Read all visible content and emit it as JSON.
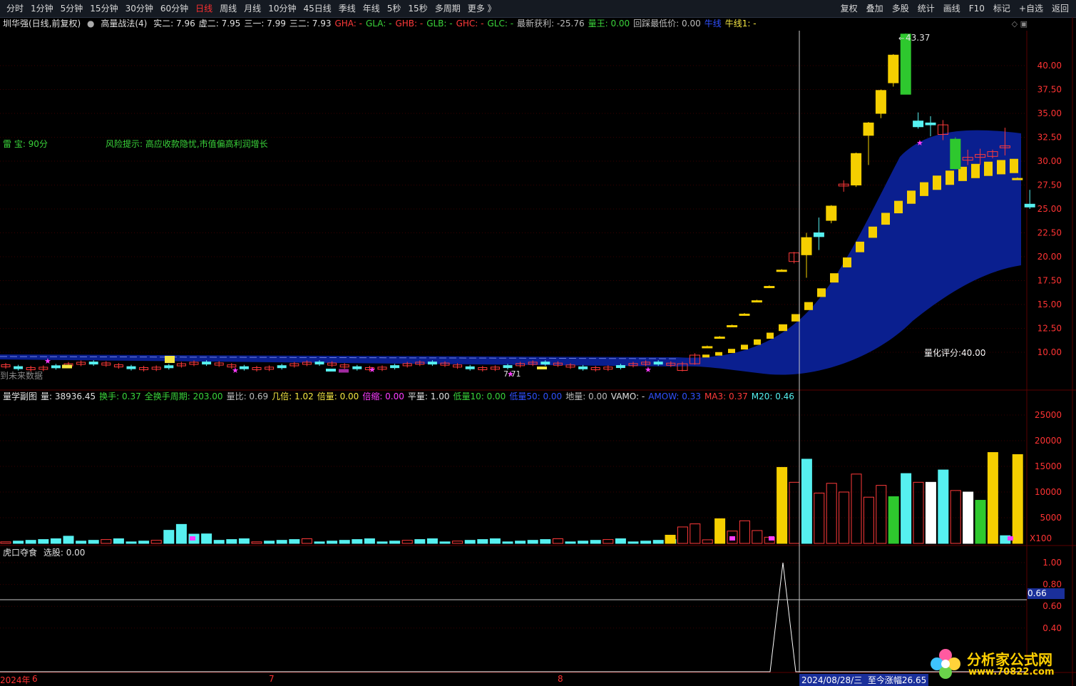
{
  "toolbar": {
    "periods": [
      "分时",
      "1分钟",
      "5分钟",
      "15分钟",
      "30分钟",
      "60分钟",
      "日线",
      "周线",
      "月线",
      "10分钟",
      "45日线",
      "季线",
      "年线",
      "5秒",
      "15秒",
      "多周期",
      "更多 》"
    ],
    "active_period": "日线",
    "tools": [
      "复权",
      "叠加",
      "多股",
      "统计",
      "画线",
      "F10",
      "标记",
      "+自选",
      "返回"
    ]
  },
  "main_info": {
    "stock": "圳华强(日线,前复权)",
    "indicator": "高量战法(4)",
    "items": [
      {
        "t": "实二: 7.96",
        "c": "white"
      },
      {
        "t": "虚二: 7.95",
        "c": "white"
      },
      {
        "t": "三一: 7.99",
        "c": "white"
      },
      {
        "t": "三二: 7.93",
        "c": "white"
      },
      {
        "t": "GHA: -",
        "c": "red"
      },
      {
        "t": "GLA: -",
        "c": "green"
      },
      {
        "t": "GHB: -",
        "c": "red"
      },
      {
        "t": "GLB: -",
        "c": "green"
      },
      {
        "t": "GHC: -",
        "c": "red"
      },
      {
        "t": "GLC: -",
        "c": "green"
      },
      {
        "t": "最新获利: -25.76",
        "c": "gray"
      },
      {
        "t": "量王: 0.00",
        "c": "green"
      },
      {
        "t": "回踩最低价: 0.00",
        "c": "gray"
      },
      {
        "t": "牛线",
        "c": "blue"
      },
      {
        "t": "牛线1: -",
        "c": "yellow"
      }
    ]
  },
  "annotations": {
    "radar": "雷 宝:   90分",
    "radar_prefix": "雷",
    "risk": "风险提示:   高应收款隐忧,市值偏高利润增长",
    "future": "到未来数据",
    "score": "量化评分:40.00",
    "high_label": "43.37",
    "low_label": "7.71"
  },
  "volume_info": {
    "items": [
      {
        "t": "量学副图",
        "c": "white"
      },
      {
        "t": "量: 38936.45",
        "c": "white"
      },
      {
        "t": "换手: 0.37",
        "c": "green"
      },
      {
        "t": "全换手周期: 203.00",
        "c": "green"
      },
      {
        "t": "量比: 0.69",
        "c": "gray"
      },
      {
        "t": "几倍: 1.02",
        "c": "yellow"
      },
      {
        "t": "倍量: 0.00",
        "c": "yellow"
      },
      {
        "t": "倍缩: 0.00",
        "c": "magenta"
      },
      {
        "t": "平量: 1.00",
        "c": "white"
      },
      {
        "t": "低量10: 0.00",
        "c": "green"
      },
      {
        "t": "低量50: 0.00",
        "c": "blue"
      },
      {
        "t": "地量: 0.00",
        "c": "gray"
      },
      {
        "t": "VAMO: -",
        "c": "white"
      },
      {
        "t": "AMOW: 0.33",
        "c": "blue"
      },
      {
        "t": "MA3: 0.37",
        "c": "red"
      },
      {
        "t": "M20: 0.46",
        "c": "cyan"
      }
    ],
    "unit": "X100"
  },
  "sub_info": {
    "title": "虎口夺食",
    "select": "选股: 0.00",
    "current": "0.66"
  },
  "date_axis": {
    "year": "2024年",
    "months": [
      "6",
      "7",
      "8"
    ],
    "cursor_date": "2024/08/28/三",
    "gain": "至今涨幅26.65"
  },
  "watermark": {
    "name": "分析家公式网",
    "url": "www.70822.com"
  },
  "chart_data": [
    {
      "type": "candlestick",
      "title": "高量战法(4)",
      "ylim": [
        7.5,
        43.5
      ],
      "y_ticks": [
        "40.00",
        "37.50",
        "35.00",
        "32.50",
        "30.00",
        "27.50",
        "25.00",
        "22.50",
        "20.00",
        "17.50",
        "15.00",
        "12.50",
        "10.00"
      ],
      "late_candles": [
        {
          "o": 8.1,
          "c": 8.8,
          "h": 9.0,
          "l": 8.0
        },
        {
          "o": 8.8,
          "c": 9.7,
          "h": 9.9,
          "l": 8.7
        },
        {
          "o": 10.6,
          "c": 10.6,
          "h": 10.7,
          "l": 10.5
        },
        {
          "o": 11.6,
          "c": 11.6,
          "h": 11.7,
          "l": 11.5
        },
        {
          "o": 12.8,
          "c": 12.8,
          "h": 12.9,
          "l": 12.7
        },
        {
          "o": 14.0,
          "c": 14.0,
          "h": 14.1,
          "l": 13.9
        },
        {
          "o": 15.4,
          "c": 15.4,
          "h": 15.5,
          "l": 15.3
        },
        {
          "o": 16.9,
          "c": 16.9,
          "h": 17.0,
          "l": 16.8
        },
        {
          "o": 18.6,
          "c": 18.6,
          "h": 18.7,
          "l": 18.5
        },
        {
          "o": 19.5,
          "c": 20.4,
          "h": 20.5,
          "l": 19.3
        },
        {
          "o": 20.2,
          "c": 22.0,
          "h": 22.5,
          "l": 17.8
        },
        {
          "o": 22.5,
          "c": 22.1,
          "h": 24.1,
          "l": 20.7
        },
        {
          "o": 23.8,
          "c": 25.3,
          "h": 25.4,
          "l": 23.5
        },
        {
          "o": 27.4,
          "c": 27.6,
          "h": 28.0,
          "l": 26.8
        },
        {
          "o": 27.5,
          "c": 30.8,
          "h": 30.9,
          "l": 27.3
        },
        {
          "o": 32.7,
          "c": 34.0,
          "h": 34.1,
          "l": 29.6
        },
        {
          "o": 35.0,
          "c": 37.4,
          "h": 37.5,
          "l": 34.5
        },
        {
          "o": 38.2,
          "c": 41.1,
          "h": 41.2,
          "l": 37.8
        },
        {
          "o": 43.3,
          "c": 37.0,
          "h": 43.37,
          "l": 37.0
        },
        {
          "o": 34.2,
          "c": 33.6,
          "h": 35.1,
          "l": 33.4
        },
        {
          "o": 34.0,
          "c": 33.8,
          "h": 34.7,
          "l": 32.6
        },
        {
          "o": 32.8,
          "c": 33.8,
          "h": 34.3,
          "l": 32.2
        },
        {
          "o": 32.3,
          "c": 29.2,
          "h": 32.5,
          "l": 29.2
        },
        {
          "o": 30.1,
          "c": 30.4,
          "h": 31.2,
          "l": 29.6
        },
        {
          "o": 30.4,
          "c": 30.7,
          "h": 31.3,
          "l": 29.6
        },
        {
          "o": 30.5,
          "c": 31.0,
          "h": 31.2,
          "l": 30.3
        },
        {
          "o": 31.4,
          "c": 31.6,
          "h": 33.5,
          "l": 30.6
        },
        {
          "o": 28.2,
          "c": 28.2,
          "h": 28.3,
          "l": 28.1
        },
        {
          "o": 25.5,
          "c": 25.2,
          "h": 27.0,
          "l": 25.0
        }
      ]
    },
    {
      "type": "bar",
      "title": "量学副图",
      "ylim": [
        0,
        25000
      ],
      "y_ticks": [
        "25000",
        "20000",
        "15000",
        "10000",
        "5000"
      ]
    },
    {
      "type": "line",
      "title": "虎口夺食",
      "ylim": [
        0,
        1.0
      ],
      "y_ticks": [
        "1.00",
        "0.80",
        "0.60",
        "0.40"
      ],
      "values": [
        0,
        0,
        0,
        0,
        1,
        0,
        0
      ]
    }
  ]
}
